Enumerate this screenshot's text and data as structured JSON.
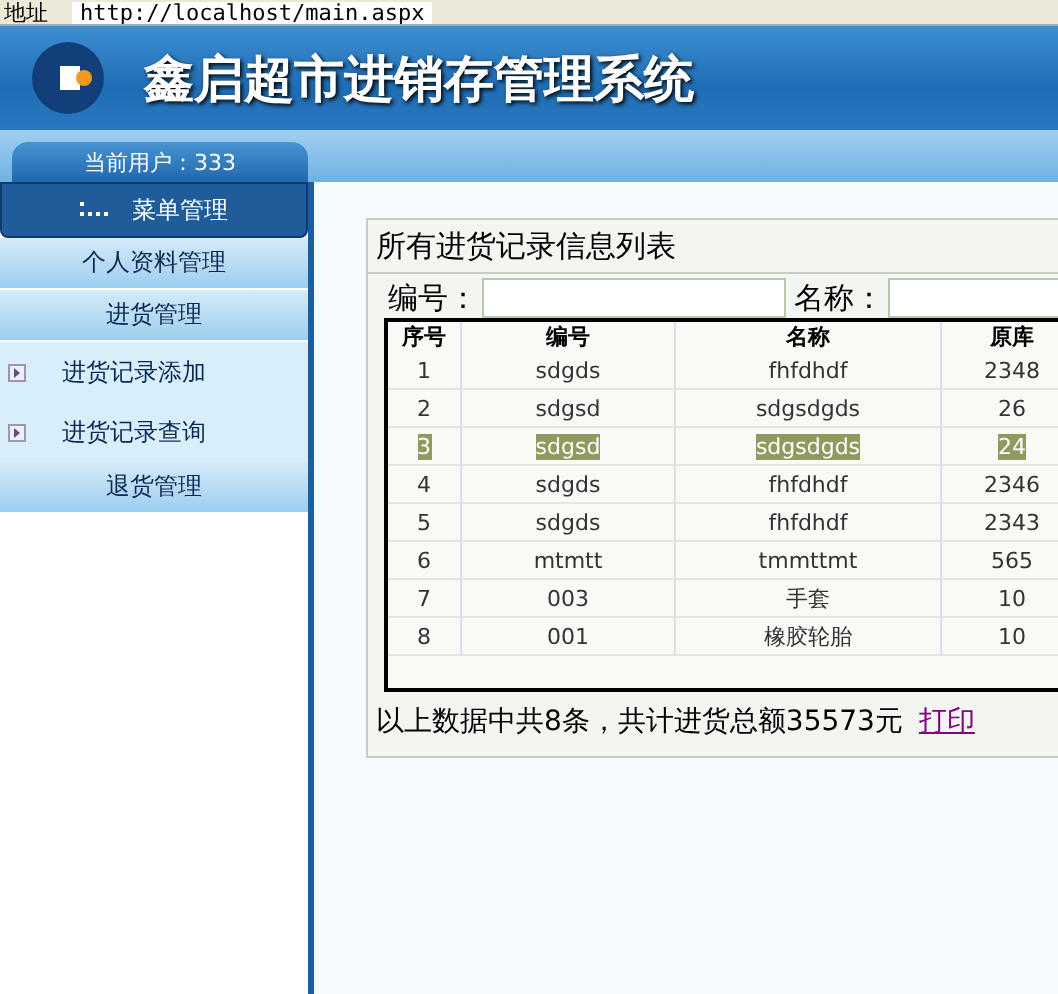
{
  "address_bar": {
    "label": "地址",
    "url": "http://localhost/main.aspx"
  },
  "header": {
    "title": "鑫启超市进销存管理系统"
  },
  "user_tab": {
    "text": "当前用户：333"
  },
  "sidebar": {
    "title": "菜单管理",
    "items": [
      {
        "kind": "section",
        "label": "个人资料管理"
      },
      {
        "kind": "section",
        "label": "进货管理"
      },
      {
        "kind": "link",
        "label": "进货记录添加"
      },
      {
        "kind": "link",
        "label": "进货记录查询"
      },
      {
        "kind": "section",
        "label": "退货管理"
      }
    ]
  },
  "panel": {
    "title": "所有进货记录信息列表",
    "filters": [
      {
        "label": "编号："
      },
      {
        "label": "名称："
      }
    ],
    "table": {
      "columns": [
        "序号",
        "编号",
        "名称",
        "原库"
      ],
      "rows": [
        {
          "cells": [
            "1",
            "sdgds",
            "fhfdhdf",
            "2348"
          ],
          "selected": false
        },
        {
          "cells": [
            "2",
            "sdgsd",
            "sdgsdgds",
            "26"
          ],
          "selected": false
        },
        {
          "cells": [
            "3",
            "sdgsd",
            "sdgsdgds",
            "24"
          ],
          "selected": true
        },
        {
          "cells": [
            "4",
            "sdgds",
            "fhfdhdf",
            "2346"
          ],
          "selected": false
        },
        {
          "cells": [
            "5",
            "sdgds",
            "fhfdhdf",
            "2343"
          ],
          "selected": false
        },
        {
          "cells": [
            "6",
            "mtmtt",
            "tmmttmt",
            "565"
          ],
          "selected": false
        },
        {
          "cells": [
            "7",
            "003",
            "手套",
            "10"
          ],
          "selected": false
        },
        {
          "cells": [
            "8",
            "001",
            "橡胶轮胎",
            "10"
          ],
          "selected": false
        }
      ]
    },
    "summary": "以上数据中共8条，共计进货总额35573元",
    "print_link": "打印"
  }
}
